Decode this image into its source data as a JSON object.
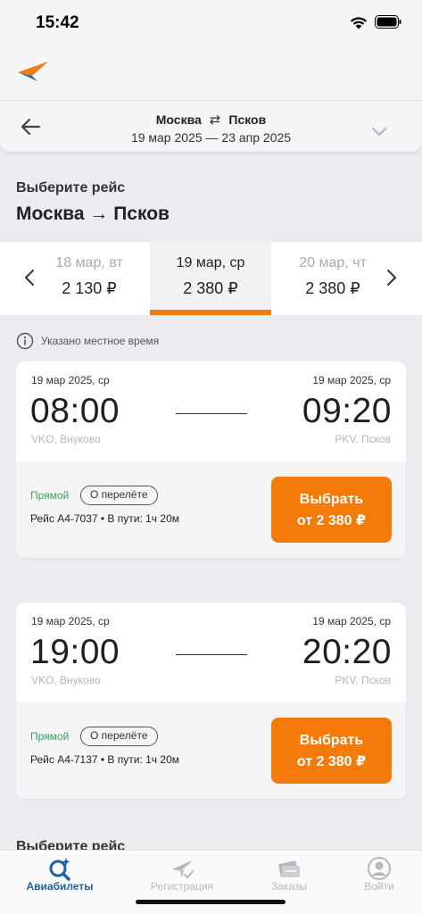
{
  "status_bar": {
    "time": "15:42"
  },
  "route_card": {
    "from": "Москва",
    "swap_symbol": "⇄",
    "to": "Псков",
    "dates": "19 мар 2025 — 23 апр 2025"
  },
  "section": {
    "heading": "Выберите рейс",
    "route": "Москва → Псков",
    "heading_next": "Выберите рейс"
  },
  "date_tabs": [
    {
      "label": "18 мар, вт",
      "price": "2 130 ₽"
    },
    {
      "label": "19 мар, ср",
      "price": "2 380 ₽"
    },
    {
      "label": "20 мар, чт",
      "price": "2 380 ₽"
    }
  ],
  "note": "Указано местное время",
  "flights": [
    {
      "dep_date": "19 мар 2025, ср",
      "arr_date": "19 мар 2025, ср",
      "dep_time": "08:00",
      "arr_time": "09:20",
      "dep_airport": "VKO, Внуково",
      "arr_airport": "PKV, Псков",
      "direct": "Прямой",
      "about": "О перелёте",
      "info": "Рейс  А4-7037  •  В пути: 1ч 20м",
      "select_l1": "Выбрать",
      "select_l2": "от 2 380 ₽"
    },
    {
      "dep_date": "19 мар 2025, ср",
      "arr_date": "19 мар 2025, ср",
      "dep_time": "19:00",
      "arr_time": "20:20",
      "dep_airport": "VKO, Внуково",
      "arr_airport": "PKV, Псков",
      "direct": "Прямой",
      "about": "О перелёте",
      "info": "Рейс  А4-7137  •  В пути: 1ч 20м",
      "select_l1": "Выбрать",
      "select_l2": "от 2 380 ₽"
    }
  ],
  "tab_bar": [
    {
      "label": "Авиабилеты",
      "icon": "ticket-search-icon"
    },
    {
      "label": "Регистрация",
      "icon": "plane-check-icon"
    },
    {
      "label": "Заказы",
      "icon": "orders-icon"
    },
    {
      "label": "Войти",
      "icon": "user-icon"
    }
  ],
  "colors": {
    "accent": "#f47a0a",
    "active_tab": "#1d5fa8",
    "direct": "#3aa360"
  }
}
